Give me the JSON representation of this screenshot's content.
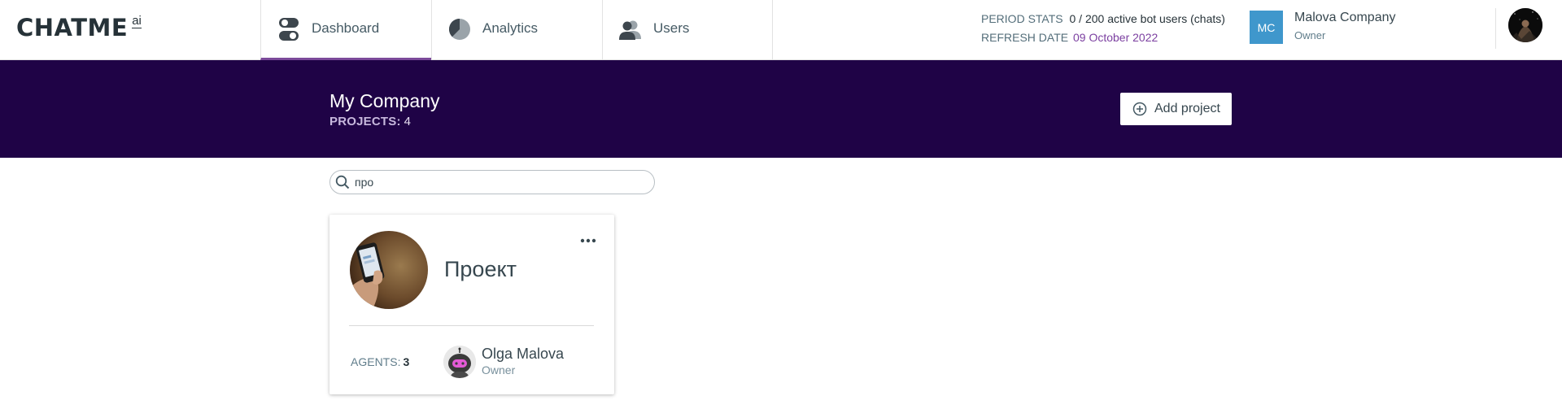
{
  "header": {
    "logo_text": "CHATME",
    "logo_suffix": "ai",
    "tabs": [
      {
        "label": "Dashboard",
        "icon": "toggle-switch-icon",
        "active": true
      },
      {
        "label": "Analytics",
        "icon": "pie-chart-icon",
        "active": false
      },
      {
        "label": "Users",
        "icon": "users-icon",
        "active": false
      }
    ],
    "stats": {
      "period_label": "PERIOD STATS",
      "period_value": "0 / 200 active bot users (chats)",
      "refresh_label": "REFRESH DATE",
      "refresh_value": "09 October 2022"
    },
    "company": {
      "initials": "MC",
      "name": "Malova Company",
      "role": "Owner"
    }
  },
  "banner": {
    "title": "My Company",
    "projects_label": "PROJECTS:",
    "projects_count": "4",
    "add_button_label": "Add project"
  },
  "search": {
    "value": "про"
  },
  "projects": [
    {
      "title": "Проект",
      "agents_label": "AGENTS:",
      "agents_count": "3",
      "owner_name": "Olga Malova",
      "owner_role": "Owner"
    }
  ],
  "colors": {
    "accent": "#7b3fa0",
    "banner_bg": "#1f0346",
    "company_badge": "#3f97cc"
  }
}
